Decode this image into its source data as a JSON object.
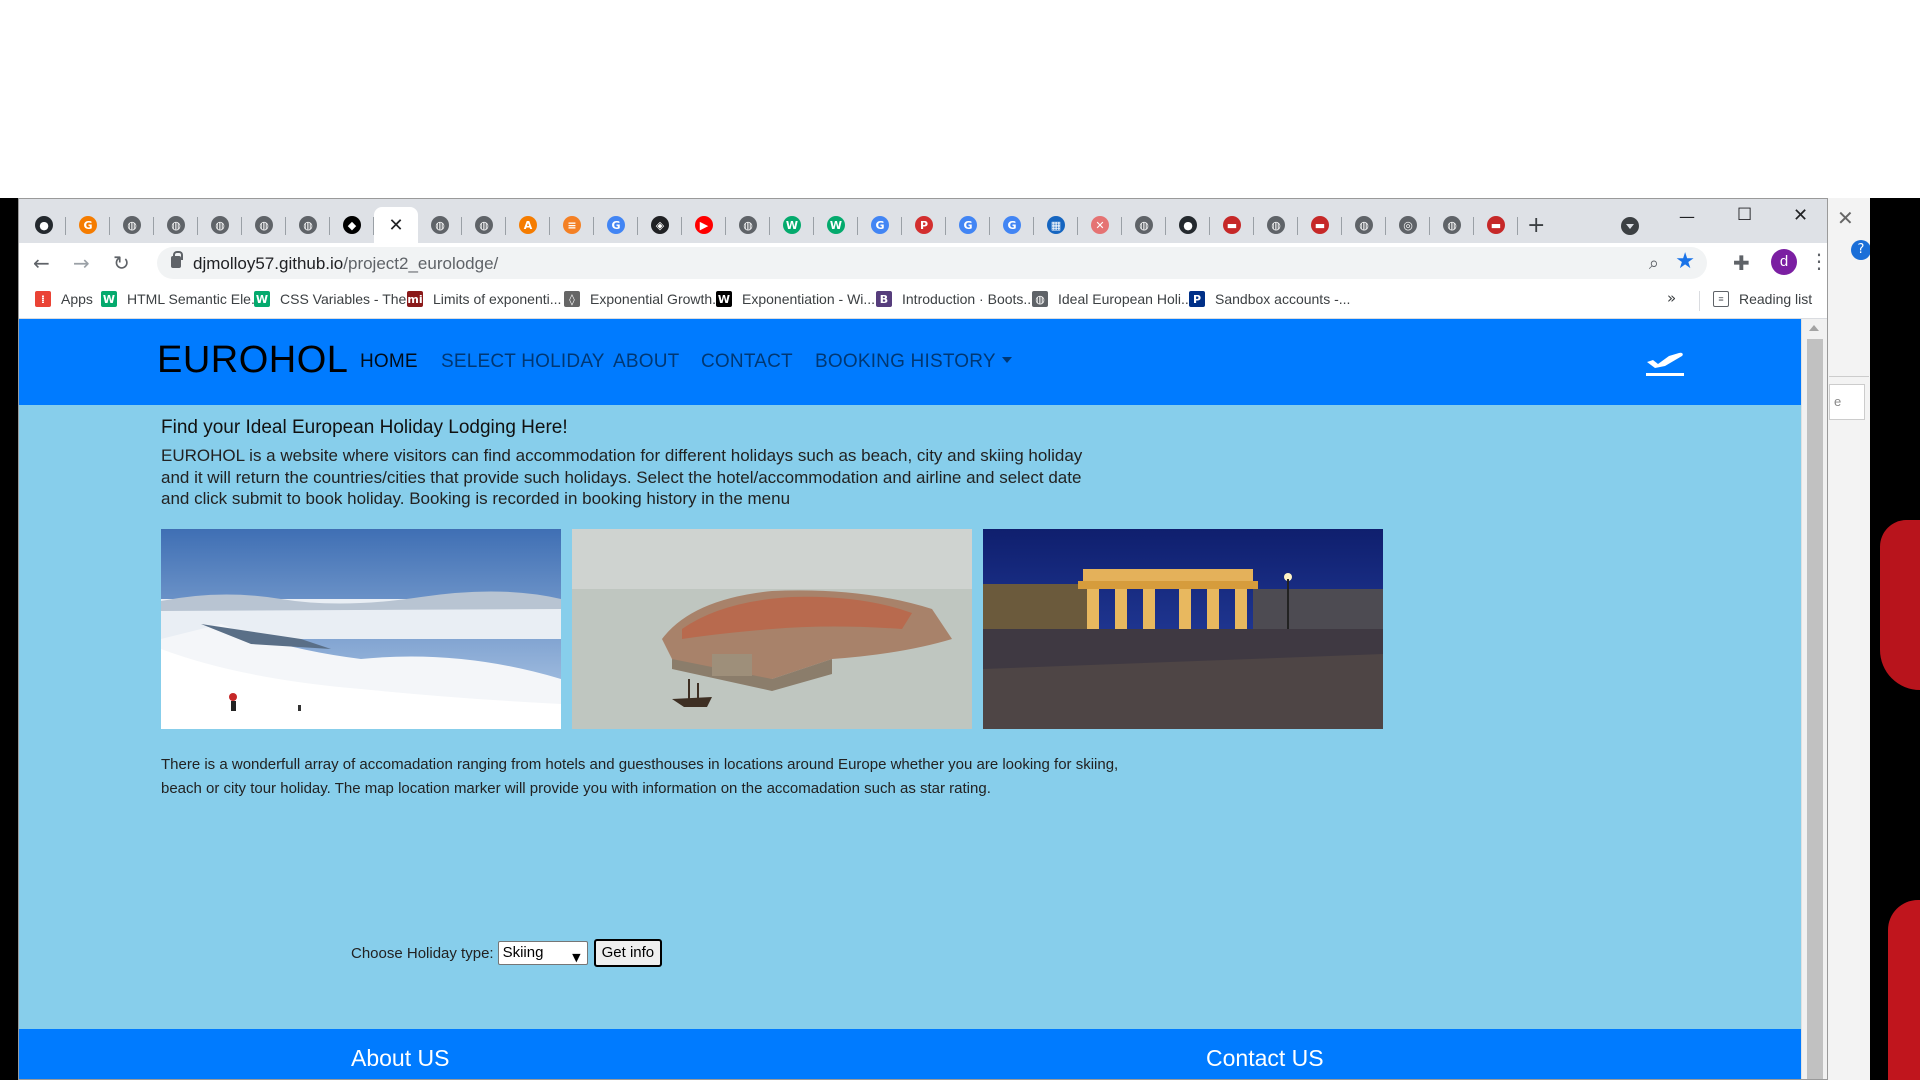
{
  "browser": {
    "url_domain": "djmolloy57.github.io",
    "url_path": "/project2_eurolodge/",
    "profile_initial": "d",
    "tabs": [
      {
        "icon": "github-icon",
        "color": "#24292e",
        "glyph": "●"
      },
      {
        "icon": "grammarly-icon",
        "color": "#f57c00",
        "glyph": "G"
      },
      {
        "icon": "globe-icon",
        "color": "#5f6368",
        "glyph": "◍"
      },
      {
        "icon": "globe-icon",
        "color": "#5f6368",
        "glyph": "◍"
      },
      {
        "icon": "globe-icon",
        "color": "#5f6368",
        "glyph": "◍"
      },
      {
        "icon": "globe-icon",
        "color": "#5f6368",
        "glyph": "◍"
      },
      {
        "icon": "globe-icon",
        "color": "#5f6368",
        "glyph": "◍"
      },
      {
        "icon": "codepen-icon",
        "color": "#000000",
        "glyph": "◆"
      },
      {
        "icon": "close-icon",
        "color": "#202124",
        "glyph": "✕",
        "active": true
      },
      {
        "icon": "globe-icon",
        "color": "#5f6368",
        "glyph": "◍"
      },
      {
        "icon": "globe-icon",
        "color": "#5f6368",
        "glyph": "◍"
      },
      {
        "icon": "ace-icon",
        "color": "#f57c00",
        "glyph": "A"
      },
      {
        "icon": "stackoverflow-icon",
        "color": "#f48024",
        "glyph": "≡"
      },
      {
        "icon": "google-icon",
        "color": "#4285f4",
        "glyph": "G"
      },
      {
        "icon": "diamond-icon",
        "color": "#202124",
        "glyph": "◈"
      },
      {
        "icon": "youtube-icon",
        "color": "#ff0000",
        "glyph": "▶"
      },
      {
        "icon": "globe-icon",
        "color": "#5f6368",
        "glyph": "◍"
      },
      {
        "icon": "w3schools-icon",
        "color": "#04aa6d",
        "glyph": "W"
      },
      {
        "icon": "w3schools-icon",
        "color": "#04aa6d",
        "glyph": "W"
      },
      {
        "icon": "google-icon",
        "color": "#4285f4",
        "glyph": "G"
      },
      {
        "icon": "pt-icon",
        "color": "#d32f2f",
        "glyph": "P"
      },
      {
        "icon": "google-icon",
        "color": "#4285f4",
        "glyph": "G"
      },
      {
        "icon": "google-icon",
        "color": "#4285f4",
        "glyph": "G"
      },
      {
        "icon": "school-icon",
        "color": "#1565c0",
        "glyph": "▦"
      },
      {
        "icon": "pdf-icon",
        "color": "#e57373",
        "glyph": "✕"
      },
      {
        "icon": "globe-icon",
        "color": "#5f6368",
        "glyph": "◍"
      },
      {
        "icon": "github-icon",
        "color": "#24292e",
        "glyph": "●"
      },
      {
        "icon": "red-doc-icon",
        "color": "#c62828",
        "glyph": "▬"
      },
      {
        "icon": "globe-icon",
        "color": "#5f6368",
        "glyph": "◍"
      },
      {
        "icon": "red-doc-icon",
        "color": "#c62828",
        "glyph": "▬"
      },
      {
        "icon": "globe-icon",
        "color": "#5f6368",
        "glyph": "◍"
      },
      {
        "icon": "chrome-icon",
        "color": "#5f6368",
        "glyph": "◎"
      },
      {
        "icon": "globe-icon",
        "color": "#5f6368",
        "glyph": "◍"
      },
      {
        "icon": "red-doc-icon",
        "color": "#c62828",
        "glyph": "▬"
      }
    ],
    "new_tab_label": "+",
    "bookmarks": [
      {
        "label": "Apps",
        "icon": "apps-grid-icon",
        "color": "#ea4335",
        "glyph": "⁞"
      },
      {
        "label": "HTML Semantic Ele...",
        "icon": "w3schools-icon",
        "color": "#04aa6d",
        "glyph": "W"
      },
      {
        "label": "CSS Variables - The...",
        "icon": "w3schools-icon",
        "color": "#04aa6d",
        "glyph": "W"
      },
      {
        "label": "Limits of exponenti...",
        "icon": "mi-icon",
        "color": "#8b1a1a",
        "glyph": "mi"
      },
      {
        "label": "Exponential Growth...",
        "icon": "geogebra-icon",
        "color": "#666666",
        "glyph": "◊"
      },
      {
        "label": "Exponentiation - Wi...",
        "icon": "wikipedia-icon",
        "color": "#000000",
        "glyph": "W"
      },
      {
        "label": "Introduction · Boots...",
        "icon": "bootstrap-icon",
        "color": "#563d7c",
        "glyph": "B"
      },
      {
        "label": "Ideal European Holi...",
        "icon": "globe-icon",
        "color": "#5f6368",
        "glyph": "◍"
      },
      {
        "label": "Sandbox accounts -...",
        "icon": "paypal-icon",
        "color": "#003087",
        "glyph": "P"
      }
    ],
    "bookmarks_more": "»",
    "reading_list": "Reading list"
  },
  "site": {
    "brand": "EUROHOL",
    "nav": [
      {
        "label": "HOME",
        "active": true
      },
      {
        "label": "SELECT HOLIDAY"
      },
      {
        "label": "ABOUT"
      },
      {
        "label": "CONTACT"
      },
      {
        "label": "BOOKING HISTORY",
        "dropdown": true
      }
    ],
    "headline": "Find your Ideal European Holiday Lodging Here!",
    "intro": "EUROHOL is a website where visitors can find accommodation for different holidays such as beach, city and skiing holiday and it will return the countries/cities that provide such holidays. Select the hotel/accommodation and airline and select date and click submit to book holiday. Booking is recorded in booking history in the menu",
    "description": "There is a wonderfull array of accomadation ranging from hotels and guesthouses in locations around Europe whether you are looking for skiing, beach or city tour holiday. The map location marker will provide you with information on the accomadation such as star rating.",
    "form": {
      "label": "Choose Holiday type:",
      "selected": "Skiing",
      "button": "Get info"
    },
    "footer": {
      "about": "About US",
      "contact": "Contact US"
    },
    "colors": {
      "navbar": "#007bff",
      "body": "#87ceeb"
    }
  },
  "behind_window": {
    "box_text": "e"
  }
}
